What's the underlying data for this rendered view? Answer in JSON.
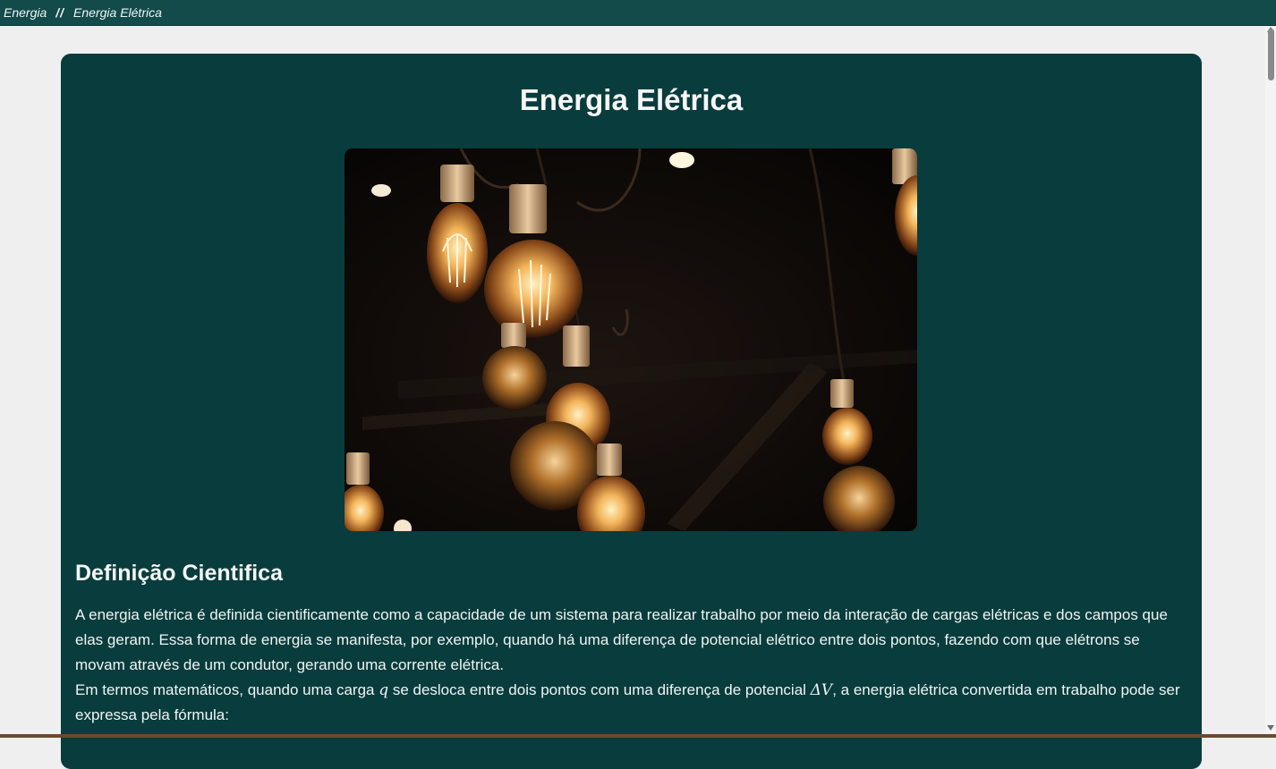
{
  "breadcrumb": {
    "items": [
      "Energia",
      "Energia Elétrica"
    ],
    "separator": "//"
  },
  "page": {
    "title": "Energia Elétrica",
    "image_subject": "hanging-edison-light-bulbs"
  },
  "section": {
    "title": "Definição Cientifica",
    "paragraph1": "A energia elétrica é definida cientificamente como a capacidade de um sistema para realizar trabalho por meio da interação de cargas elétricas e dos campos que elas geram. Essa forma de energia se manifesta, por exemplo, quando há uma diferença de potencial elétrico entre dois pontos, fazendo com que elétrons se movam através de um condutor, gerando uma corrente elétrica.",
    "paragraph2_part1": "Em termos matemáticos, quando uma carga ",
    "paragraph2_var_q": "q",
    "paragraph2_part2": " se desloca entre dois pontos com uma diferença de potencial ",
    "paragraph2_var_dv": "ΔV",
    "paragraph2_part3": ", a energia elétrica convertida em trabalho pode ser expressa pela fórmula:"
  },
  "colors": {
    "topbar": "#134a4a",
    "card": "#093c3c",
    "page_background": "#efefef"
  }
}
